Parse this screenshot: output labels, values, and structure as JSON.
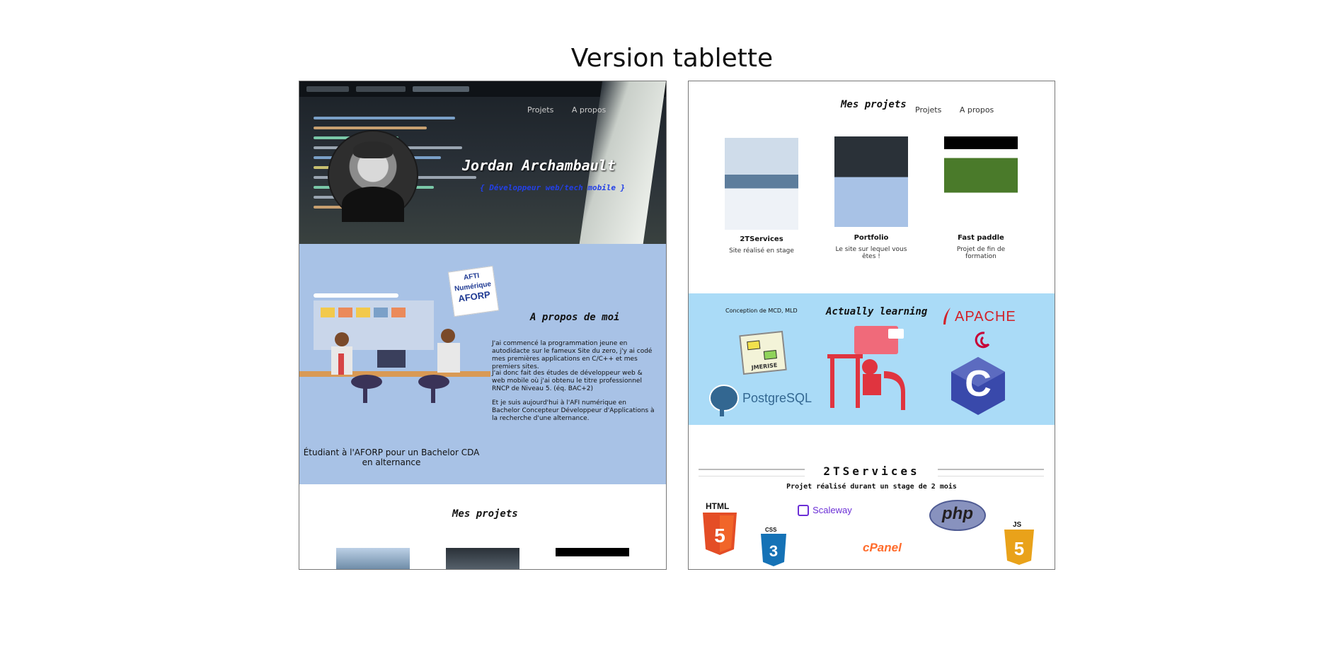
{
  "page": {
    "title": "Version tablette"
  },
  "nav": {
    "projects": "Projets",
    "about": "A propos"
  },
  "hero": {
    "name": "Jordan Archambault",
    "role": "{ Développeur web/tech mobile }"
  },
  "about": {
    "title": "A propos de moi",
    "paragraphs": [
      "J'ai commencé la programmation jeune en autodidacte sur le fameux Site du zero, j'y ai codé mes premières applications en C/C++ et mes premiers sites.",
      "J'ai donc fait des études de développeur web & web mobile où j'ai obtenu le titre professionnel RNCP de Niveau 5. (éq. BAC+2)",
      "Et je suis aujourd'hui à l'AFI numérique en Bachelor Concepteur Développeur d'Applications à la recherche d'une alternance."
    ],
    "caption": "Étudiant à l'AFORP pour un Bachelor CDA en alternance",
    "badge_lines": [
      "AFTI",
      "Numérique",
      "AFORP"
    ]
  },
  "projects": {
    "title": "Mes projets",
    "items": [
      {
        "title": "2TServices",
        "desc": "Site réalisé en stage"
      },
      {
        "title": "Portfolio",
        "desc": "Le site sur lequel vous êtes !"
      },
      {
        "title": "Fast paddle",
        "desc": "Projet de fin de formation"
      }
    ]
  },
  "skills": {
    "merise_caption": "Conception de MCD, MLD",
    "merise_label": "JMERISE",
    "learning_title": "Actually learning",
    "apache": "APACHE",
    "postgres": "PostgreSQL",
    "c_letter": "C"
  },
  "project_detail": {
    "title": "2TServices",
    "subtitle": "Projet réalisé durant un stage de 2 mois",
    "logos": {
      "html": "HTML",
      "css": "CSS",
      "js": "JS",
      "scaleway": "Scaleway",
      "php": "php",
      "cpanel": "cPanel"
    }
  },
  "colors": {
    "about_bg": "#a8c2e6",
    "skills_bg": "#aadbf7",
    "role_blue": "#2340e8"
  }
}
